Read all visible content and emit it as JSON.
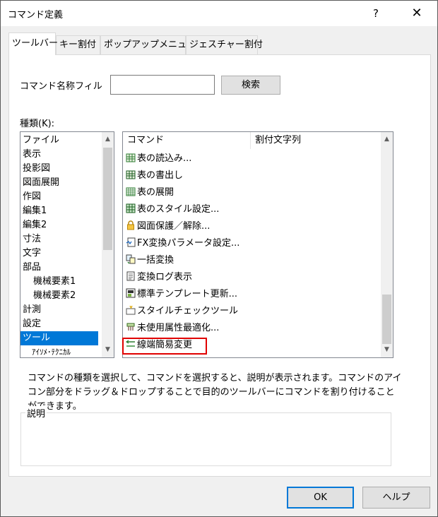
{
  "window": {
    "title": "コマンド定義",
    "help_glyph": "?",
    "close_glyph": "✕"
  },
  "tabs": [
    {
      "label": "ツールバー",
      "active": true
    },
    {
      "label": "キー割付",
      "active": false
    },
    {
      "label": "ポップアップメニュー",
      "active": false
    },
    {
      "label": "ジェスチャー割付",
      "active": false
    }
  ],
  "filter": {
    "label": "コマンド名称フィル",
    "value": "",
    "search_label": "検索"
  },
  "category": {
    "label": "種類(K):",
    "items": [
      "ファイル",
      "表示",
      "投影図",
      "図面展開",
      "作図",
      "編集1",
      "編集2",
      "寸法",
      "文字",
      "部品",
      "機械要素1",
      "機械要素2",
      "計測",
      "設定",
      "ツール",
      "ｱｲｿﾒ･ﾃｸﾆｶﾙ"
    ],
    "selected": "ツール"
  },
  "commands": {
    "headers": [
      "コマンド",
      "割付文字列"
    ],
    "rows": [
      {
        "label": "表の読込み...",
        "icon": "table-import-icon"
      },
      {
        "label": "表の書出し",
        "icon": "table-export-icon"
      },
      {
        "label": "表の展開",
        "icon": "table-expand-icon"
      },
      {
        "label": "表のスタイル設定...",
        "icon": "table-style-icon"
      },
      {
        "label": "図面保護／解除...",
        "icon": "lock-icon"
      },
      {
        "label": "FX変換パラメータ設定...",
        "icon": "fx-settings-icon"
      },
      {
        "label": "一括変換",
        "icon": "batch-convert-icon"
      },
      {
        "label": "変換ログ表示",
        "icon": "log-icon"
      },
      {
        "label": "標準テンプレート更新...",
        "icon": "template-update-icon"
      },
      {
        "label": "スタイルチェックツール",
        "icon": "style-check-icon"
      },
      {
        "label": "未使用属性最適化...",
        "icon": "optimize-icon"
      },
      {
        "label": "線端簡易変更",
        "icon": "line-end-icon"
      }
    ],
    "highlighted": "線端簡易変更"
  },
  "description_text": "コマンドの種類を選択して、コマンドを選択すると、説明が表示されます。コマンドのアイコン部分をドラッグ＆ドロップすることで目的のツールバーにコマンドを割り付けることができます。",
  "explanation_label": "説明",
  "buttons": {
    "ok": "OK",
    "help": "ヘルプ"
  },
  "colors": {
    "selection": "#0078d7",
    "highlight_border": "#e00000"
  }
}
